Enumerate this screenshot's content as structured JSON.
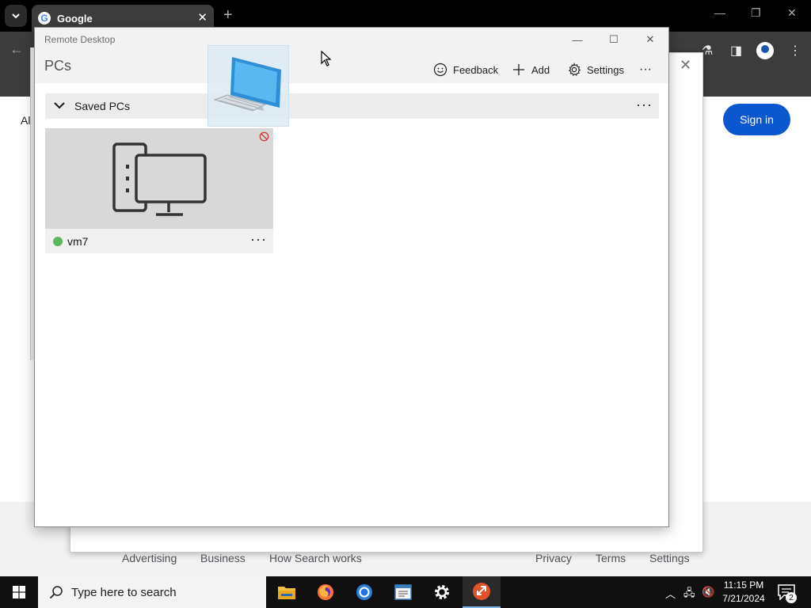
{
  "browser": {
    "tab_title": "Google",
    "tab_icon": "G",
    "page_left_text": "Al",
    "sign_in_label": "Sign in",
    "footer_links": [
      "Advertising",
      "Business",
      "How Search works",
      "Privacy",
      "Terms",
      "Settings"
    ]
  },
  "remote_desktop": {
    "app_title": "Remote Desktop",
    "page_title": "PCs",
    "commands": {
      "feedback": "Feedback",
      "add": "Add",
      "settings": "Settings",
      "more": "···"
    },
    "group": {
      "label": "Saved PCs",
      "more": "···"
    },
    "pcs": [
      {
        "name": "vm7",
        "status_color": "#5cb85c",
        "more": "···"
      }
    ]
  },
  "taskbar": {
    "search_placeholder": "Type here to search",
    "time": "11:15 PM",
    "date": "7/21/2024",
    "notification_count": "2",
    "apps": [
      "file-explorer",
      "firefox",
      "chrome",
      "notepad",
      "settings",
      "remote-desktop"
    ]
  },
  "colors": {
    "accent_blue": "#0b57d0",
    "online_green": "#5cb85c",
    "taskbar_bg": "#101010"
  }
}
